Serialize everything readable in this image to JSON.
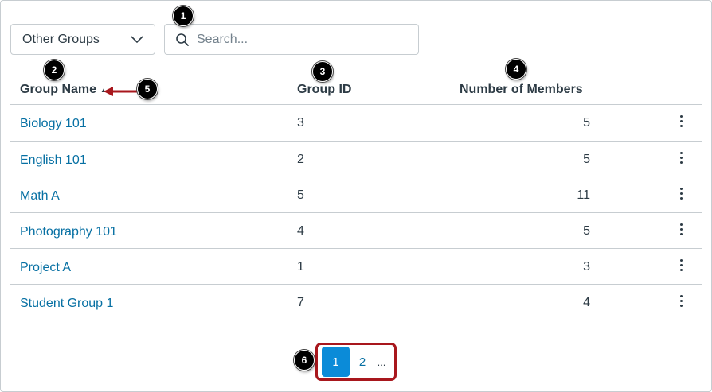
{
  "filter": {
    "selected": "Other Groups"
  },
  "search": {
    "placeholder": "Search..."
  },
  "columns": {
    "name": "Group Name",
    "id": "Group ID",
    "members": "Number of Members"
  },
  "rows": [
    {
      "name": "Biology 101",
      "id": "3",
      "members": "5"
    },
    {
      "name": "English 101",
      "id": "2",
      "members": "5"
    },
    {
      "name": "Math A",
      "id": "5",
      "members": "11"
    },
    {
      "name": "Photography 101",
      "id": "4",
      "members": "5"
    },
    {
      "name": "Project A",
      "id": "1",
      "members": "3"
    },
    {
      "name": "Student Group 1",
      "id": "7",
      "members": "4"
    }
  ],
  "pagination": {
    "current": "1",
    "next": "2",
    "ellipsis": "..."
  },
  "callouts": [
    "1",
    "2",
    "3",
    "4",
    "5",
    "6"
  ],
  "colors": {
    "link": "#0770a3",
    "active_page": "#0b8bd8",
    "highlight": "#a8171d",
    "text": "#2d3b45"
  },
  "icons": {
    "sort": "sort-ascending-icon",
    "search": "search-icon",
    "select": "chevron-down-icon",
    "row_menu": "kebab-menu-icon"
  }
}
